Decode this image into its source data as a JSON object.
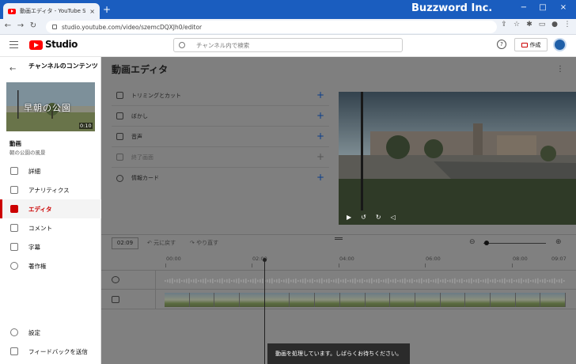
{
  "browser": {
    "tab_title": "動画エディタ - YouTube Studio",
    "tab_close": "×",
    "new_tab": "+",
    "url": "studio.youtube.com/video/szemcDQXJh0/editor",
    "window_minimize": "−",
    "window_maximize": "□",
    "window_close": "×"
  },
  "watermark": "Buzzword Inc.",
  "studio": {
    "logo_text": "Studio",
    "search_placeholder": "チャンネル内で検索",
    "help": "?",
    "create_label": "作成"
  },
  "sidebar": {
    "back": "←",
    "channel_title": "チャンネルのコンテンツ",
    "thumbnail_title": "早朝の公園",
    "thumbnail_duration": "0:10",
    "video_label": "動画",
    "video_name": "朝の公園の風景",
    "items": [
      {
        "label": "詳細"
      },
      {
        "label": "アナリティクス"
      },
      {
        "label": "エディタ",
        "active": true
      },
      {
        "label": "コメント"
      },
      {
        "label": "字幕"
      },
      {
        "label": "著作権"
      }
    ],
    "bottom_items": [
      {
        "label": "設定"
      },
      {
        "label": "フィードバックを送信"
      }
    ]
  },
  "editor": {
    "title": "動画エディタ",
    "tools": [
      {
        "label": "トリミングとカット",
        "icon": "scissors-icon"
      },
      {
        "label": "ぼかし",
        "icon": "blur-icon"
      },
      {
        "label": "音声",
        "icon": "music-note-icon"
      },
      {
        "label": "終了画面",
        "icon": "end-screen-icon",
        "disabled": true
      },
      {
        "label": "情報カード",
        "icon": "info-icon"
      }
    ],
    "add": "+"
  },
  "timeline": {
    "current_time": "02:09",
    "undo_label": "元に戻す",
    "redo_label": "やり直す",
    "ticks": [
      "00:00",
      "02:00",
      "04:00",
      "06:00",
      "08:00",
      "09:07"
    ],
    "zoom_level": 0.0
  },
  "toast": "動画を処理しています。しばらくお待ちください。",
  "colors": {
    "accent_red": "#cc0000",
    "browser_blue": "#1a5dbf",
    "overlay_gray": "#7f7f7f"
  }
}
